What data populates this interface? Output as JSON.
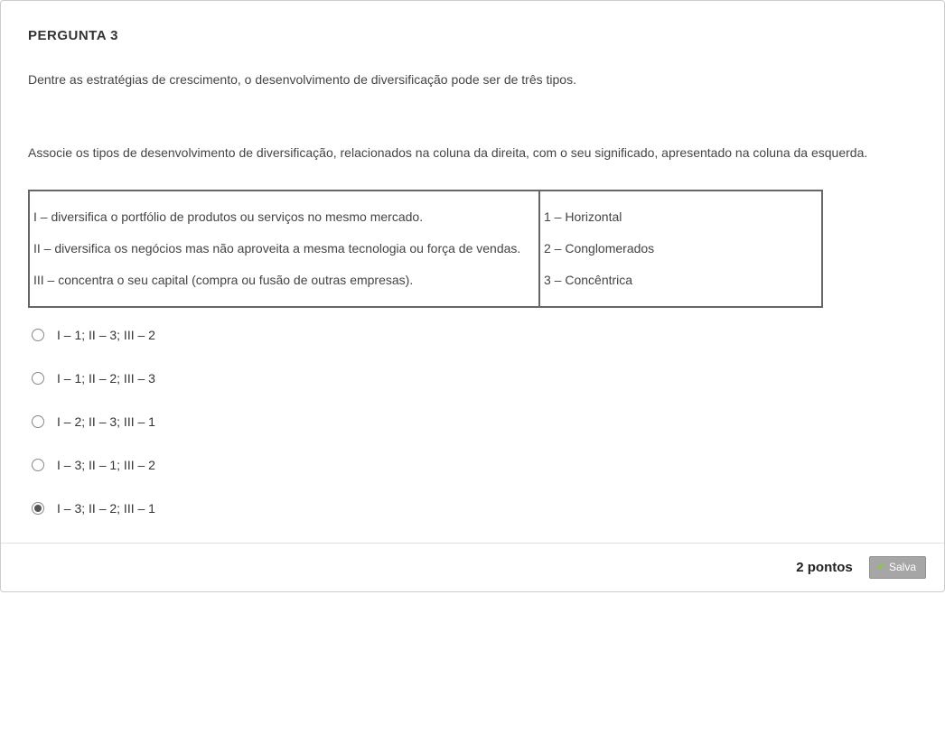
{
  "question": {
    "title": "PERGUNTA 3",
    "para1": "Dentre as estratégias de crescimento, o desenvolvimento de diversificação pode ser de três tipos.",
    "para2": "Associe os tipos de desenvolvimento de diversificação, relacionados na coluna da direita, com o seu significado, apresentado na coluna da esquerda.",
    "left": {
      "i": "I – diversifica o portfólio de produtos ou serviços no mesmo mercado.",
      "ii": "II – diversifica os negócios mas não aproveita a mesma tecnologia ou força de vendas.",
      "iii": "III – concentra o seu capital (compra ou fusão de outras empresas)."
    },
    "right": {
      "r1": "1 – Horizontal",
      "r2": "2 – Conglomerados",
      "r3": "3 – Concêntrica"
    },
    "options": [
      "I – 1; II – 3; III – 2",
      "I – 1; II – 2; III – 3",
      "I – 2; II – 3; III – 1",
      "I – 3; II – 1; III – 2",
      "I – 3; II – 2; III – 1"
    ],
    "selected_index": 4
  },
  "footer": {
    "points_label": "2 pontos",
    "save_label": "Salva"
  }
}
